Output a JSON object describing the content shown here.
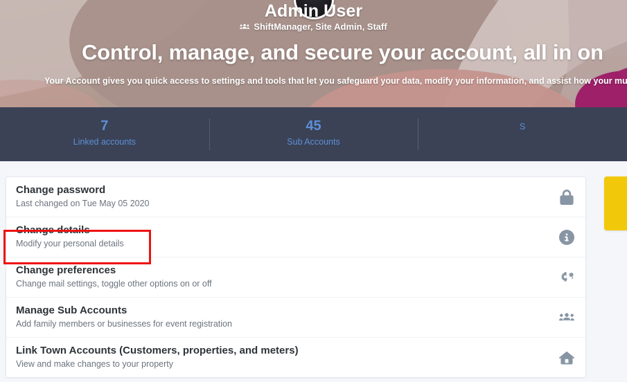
{
  "hero": {
    "user_name": "Admin User",
    "user_roles": "ShiftManager, Site Admin, Staff",
    "roles_icon": "users-icon",
    "title": "Control, manage, and secure your account, all in on",
    "subtitle": "Your Account gives you quick access to settings and tools that let you safeguard your data, modify your information, and assist how your municipal eSe",
    "avatar_icon": "user-avatar",
    "bg_colors": {
      "base": "#b09a90",
      "light_blob": "#c9b9b4",
      "pale_blob": "#d8cdca",
      "rose_blob": "#c99a94",
      "magenta_blob": "#a0216b"
    }
  },
  "stats": {
    "accent_color": "#5d8fd6",
    "bar_color": "#3b4256",
    "items": [
      {
        "value": "7",
        "label": "Linked accounts"
      },
      {
        "value": "45",
        "label": "Sub Accounts"
      },
      {
        "value": "",
        "label": "S"
      }
    ]
  },
  "settings": {
    "rows": [
      {
        "title": "Change password",
        "desc": "Last changed on Tue May 05 2020",
        "icon": "lock-icon"
      },
      {
        "title": "Change details",
        "desc": "Modify your personal details",
        "icon": "info-circle-icon"
      },
      {
        "title": "Change preferences",
        "desc": "Change mail settings, toggle other options on or off",
        "icon": "cogs-icon"
      },
      {
        "title": "Manage Sub Accounts",
        "desc": "Add family members or businesses for event registration",
        "icon": "users-icon"
      },
      {
        "title": "Link Town Accounts (Customers, properties, and meters)",
        "desc": "View and make changes to your property",
        "icon": "home-icon"
      }
    ]
  },
  "annotation": {
    "highlight_color": "#ee1111",
    "target": "Change details"
  },
  "promo": {
    "color": "#f2c80a"
  }
}
